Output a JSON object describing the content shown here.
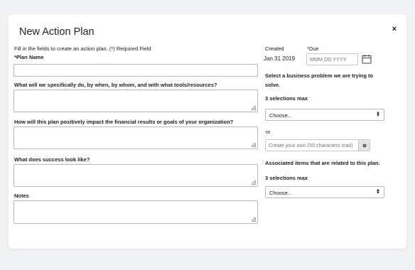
{
  "modal": {
    "title": "New Action Plan",
    "close_label": "×",
    "instructions": "Fill in the fields to create an action plan. (*) Required Field"
  },
  "form": {
    "plan_name_label": "*Plan Name",
    "what_label": "What will we specifically do, by when, by whom, and with what tools/resources?",
    "impact_label": "How will this plan positively impact the financial results or goals of your organization?",
    "success_label": "What does success look like?",
    "notes_label": "Notes"
  },
  "side": {
    "created_label": "Created",
    "created_value": "Jan 31 2019",
    "due_label": "*Due",
    "due_placeholder": "MMM DD YYYY",
    "business_problem_label": "Select a business problem we are trying to solve.",
    "selections_max_1": "3 selections max",
    "select_1_value": "Choose...",
    "or_label": "or",
    "custom_placeholder": "Create your own (50 characters max)",
    "associated_label": "Associated items that are related to this plan.",
    "selections_max_2": "3 selections max",
    "select_2_value": "Choose..."
  },
  "icons": {
    "close": "close-icon",
    "calendar": "calendar-icon",
    "gear": "gear-icon",
    "select_arrows": "select-arrows-icon",
    "resize": "resize-grip-icon"
  }
}
